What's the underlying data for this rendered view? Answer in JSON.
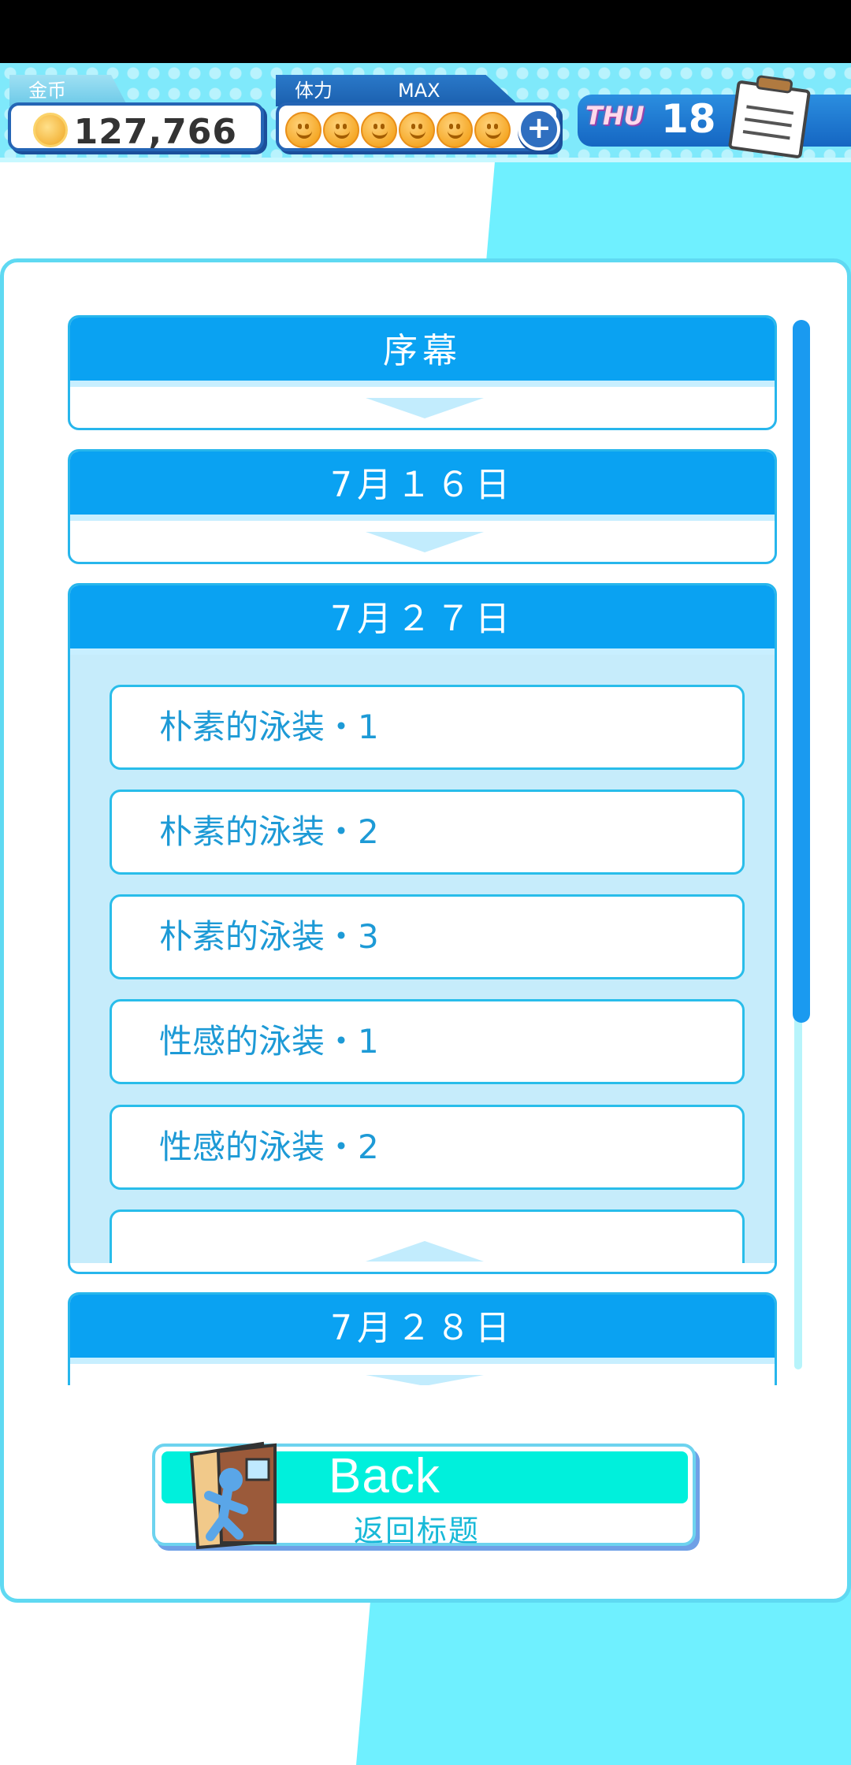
{
  "hud": {
    "coins_label": "金币",
    "coins_value": "127,766",
    "stamina_label": "体力",
    "stamina_max": "MAX",
    "stamina_icon_count": 6,
    "day_name": "THU",
    "day_number": "18"
  },
  "chapters": [
    {
      "title": "序幕",
      "expanded": false
    },
    {
      "title": "7月１６日",
      "expanded": false
    },
    {
      "title": "7月２７日",
      "expanded": true,
      "episodes": [
        "朴素的泳装・1",
        "朴素的泳装・2",
        "朴素的泳装・3",
        "性感的泳装・1",
        "性感的泳装・2"
      ]
    },
    {
      "title": "7月２８日",
      "expanded": false
    }
  ],
  "back_button": {
    "title": "Back",
    "subtitle": "返回标题"
  },
  "colors": {
    "header_blue": "#0aa2f2",
    "episode_text": "#1d9ad6",
    "background_cyan": "#6ff0ff",
    "back_stripe": "#00f0dc"
  }
}
